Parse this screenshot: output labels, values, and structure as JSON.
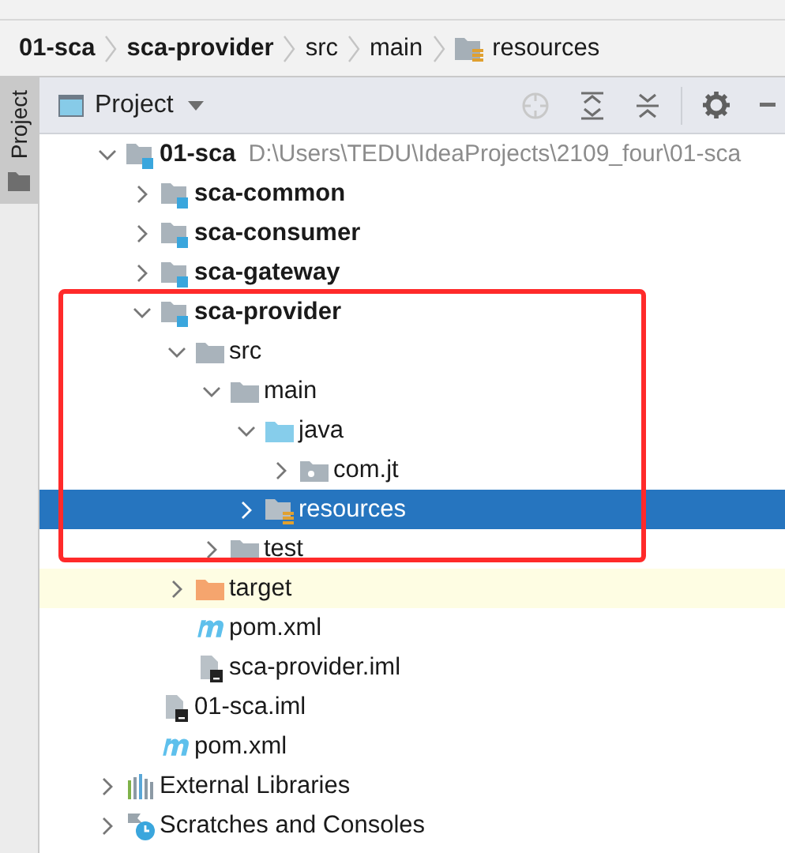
{
  "breadcrumb": [
    {
      "label": "01-sca",
      "kind": "module"
    },
    {
      "label": "sca-provider",
      "kind": "module"
    },
    {
      "label": "src",
      "kind": "plain"
    },
    {
      "label": "main",
      "kind": "plain"
    },
    {
      "label": "resources",
      "kind": "resources"
    }
  ],
  "side_tab": {
    "label": "Project",
    "selected": true
  },
  "panel": {
    "title": "Project"
  },
  "tree": [
    {
      "label": "01-sca",
      "kind": "module",
      "path": "D:\\Users\\TEDU\\IdeaProjects\\2109_four\\01-sca",
      "expanded": true,
      "selected": false,
      "children": [
        {
          "label": "sca-common",
          "kind": "module",
          "expanded": false,
          "selected": false
        },
        {
          "label": "sca-consumer",
          "kind": "module",
          "expanded": false,
          "selected": false
        },
        {
          "label": "sca-gateway",
          "kind": "module",
          "expanded": false,
          "selected": false
        },
        {
          "label": "sca-provider",
          "kind": "module",
          "expanded": true,
          "selected": false,
          "children": [
            {
              "label": "src",
              "kind": "folder",
              "expanded": true,
              "selected": false,
              "children": [
                {
                  "label": "main",
                  "kind": "folder",
                  "expanded": true,
                  "selected": false,
                  "children": [
                    {
                      "label": "java",
                      "kind": "source",
                      "expanded": true,
                      "selected": false,
                      "children": [
                        {
                          "label": "com.jt",
                          "kind": "package",
                          "expanded": false,
                          "selected": false
                        }
                      ]
                    },
                    {
                      "label": "resources",
                      "kind": "resources",
                      "expanded": false,
                      "selected": true
                    }
                  ]
                },
                {
                  "label": "test",
                  "kind": "folder",
                  "expanded": false,
                  "selected": false
                }
              ]
            },
            {
              "label": "target",
              "kind": "excluded",
              "expanded": false,
              "selected": false
            },
            {
              "label": "pom.xml",
              "kind": "maven",
              "selected": false
            },
            {
              "label": "sca-provider.iml",
              "kind": "iml",
              "selected": false
            }
          ]
        },
        {
          "label": "01-sca.iml",
          "kind": "iml",
          "selected": false
        },
        {
          "label": "pom.xml",
          "kind": "maven",
          "selected": false
        }
      ]
    },
    {
      "label": "External Libraries",
      "kind": "libraries",
      "expanded": false,
      "selected": false
    },
    {
      "label": "Scratches and Consoles",
      "kind": "scratches",
      "expanded": false,
      "selected": false
    }
  ],
  "annotation": {
    "kind": "frame"
  }
}
